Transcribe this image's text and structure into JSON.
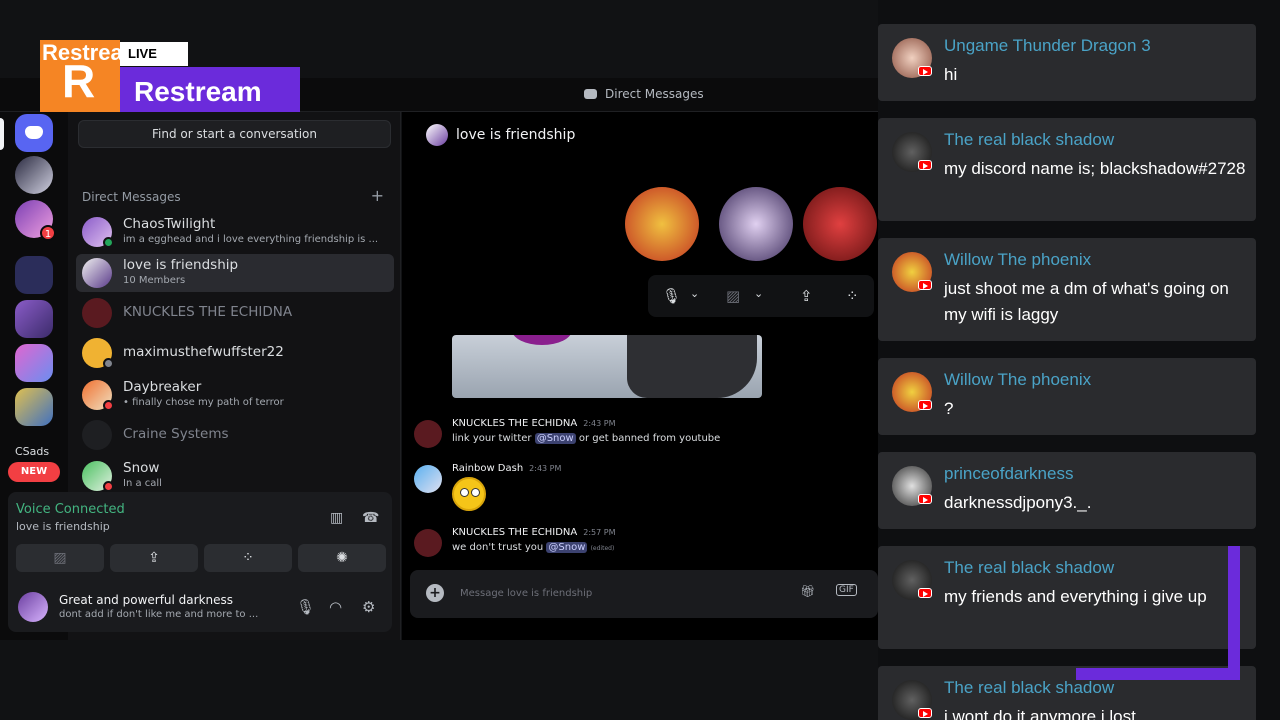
{
  "top_bar": {
    "title": "Direct Messages"
  },
  "restream": {
    "logo_small": "Restream",
    "live_label": "LIVE",
    "logo_large": "Restream"
  },
  "rail": {
    "csads_label": "CSads",
    "new_badge": "NEW",
    "badge_count_1": "1"
  },
  "sidebar": {
    "search_placeholder": "Find or start a conversation",
    "dm_header": "Direct Messages",
    "add_dm": "+",
    "items": [
      {
        "name": "ChaosTwilight",
        "status": "im a egghead and i love everything friendship is ..."
      },
      {
        "name": "love is friendship",
        "status": "10 Members"
      },
      {
        "name": "KNUCKLES THE ECHIDNA",
        "status": ""
      },
      {
        "name": "maximusthefwuffster22",
        "status": ""
      },
      {
        "name": "Daybreaker",
        "status": "• finally chose my path of terror"
      },
      {
        "name": "Craine Systems",
        "status": ""
      },
      {
        "name": "Snow",
        "status": "In a call"
      }
    ]
  },
  "voice": {
    "status": "Voice Connected",
    "channel": "love is friendship",
    "user_name": "Great and powerful darkness",
    "user_status": "dont add if don't like me and more to ..."
  },
  "chat": {
    "channel_name": "love is friendship",
    "composer_placeholder": "Message love is friendship",
    "messages": [
      {
        "author": "KNUCKLES THE ECHIDNA",
        "time": "2:43 PM",
        "pre": "link your twitter ",
        "mention": "@Snow",
        "post": " or get banned from youtube"
      },
      {
        "author": "Rainbow Dash",
        "time": "2:43 PM"
      },
      {
        "author": "KNUCKLES THE ECHIDNA",
        "time": "2:57 PM",
        "pre": "we don't trust you ",
        "mention": "@Snow",
        "post": "",
        "edited": "(edited)"
      }
    ]
  },
  "chat_overlay": [
    {
      "name": "Ungame Thunder Dragon 3",
      "text": "hi"
    },
    {
      "name": "The real black shadow",
      "text": "my discord name is; blackshadow#2728"
    },
    {
      "name": "Willow The phoenix",
      "text": "just shoot me a dm of what's going on my wifi is laggy"
    },
    {
      "name": "Willow The phoenix",
      "text": "?"
    },
    {
      "name": "princeofdarkness",
      "text": "darknessdjpony3._."
    },
    {
      "name": "The real black shadow",
      "text": "my friends and everything i give up"
    },
    {
      "name": "The real black shadow",
      "text": "i wont do it anymore i lost"
    }
  ],
  "colors": {
    "restream_orange": "#f58524",
    "restream_purple": "#6b2bdb",
    "discord_blurple": "#5865f2",
    "chat_name": "#4aa3c7"
  }
}
